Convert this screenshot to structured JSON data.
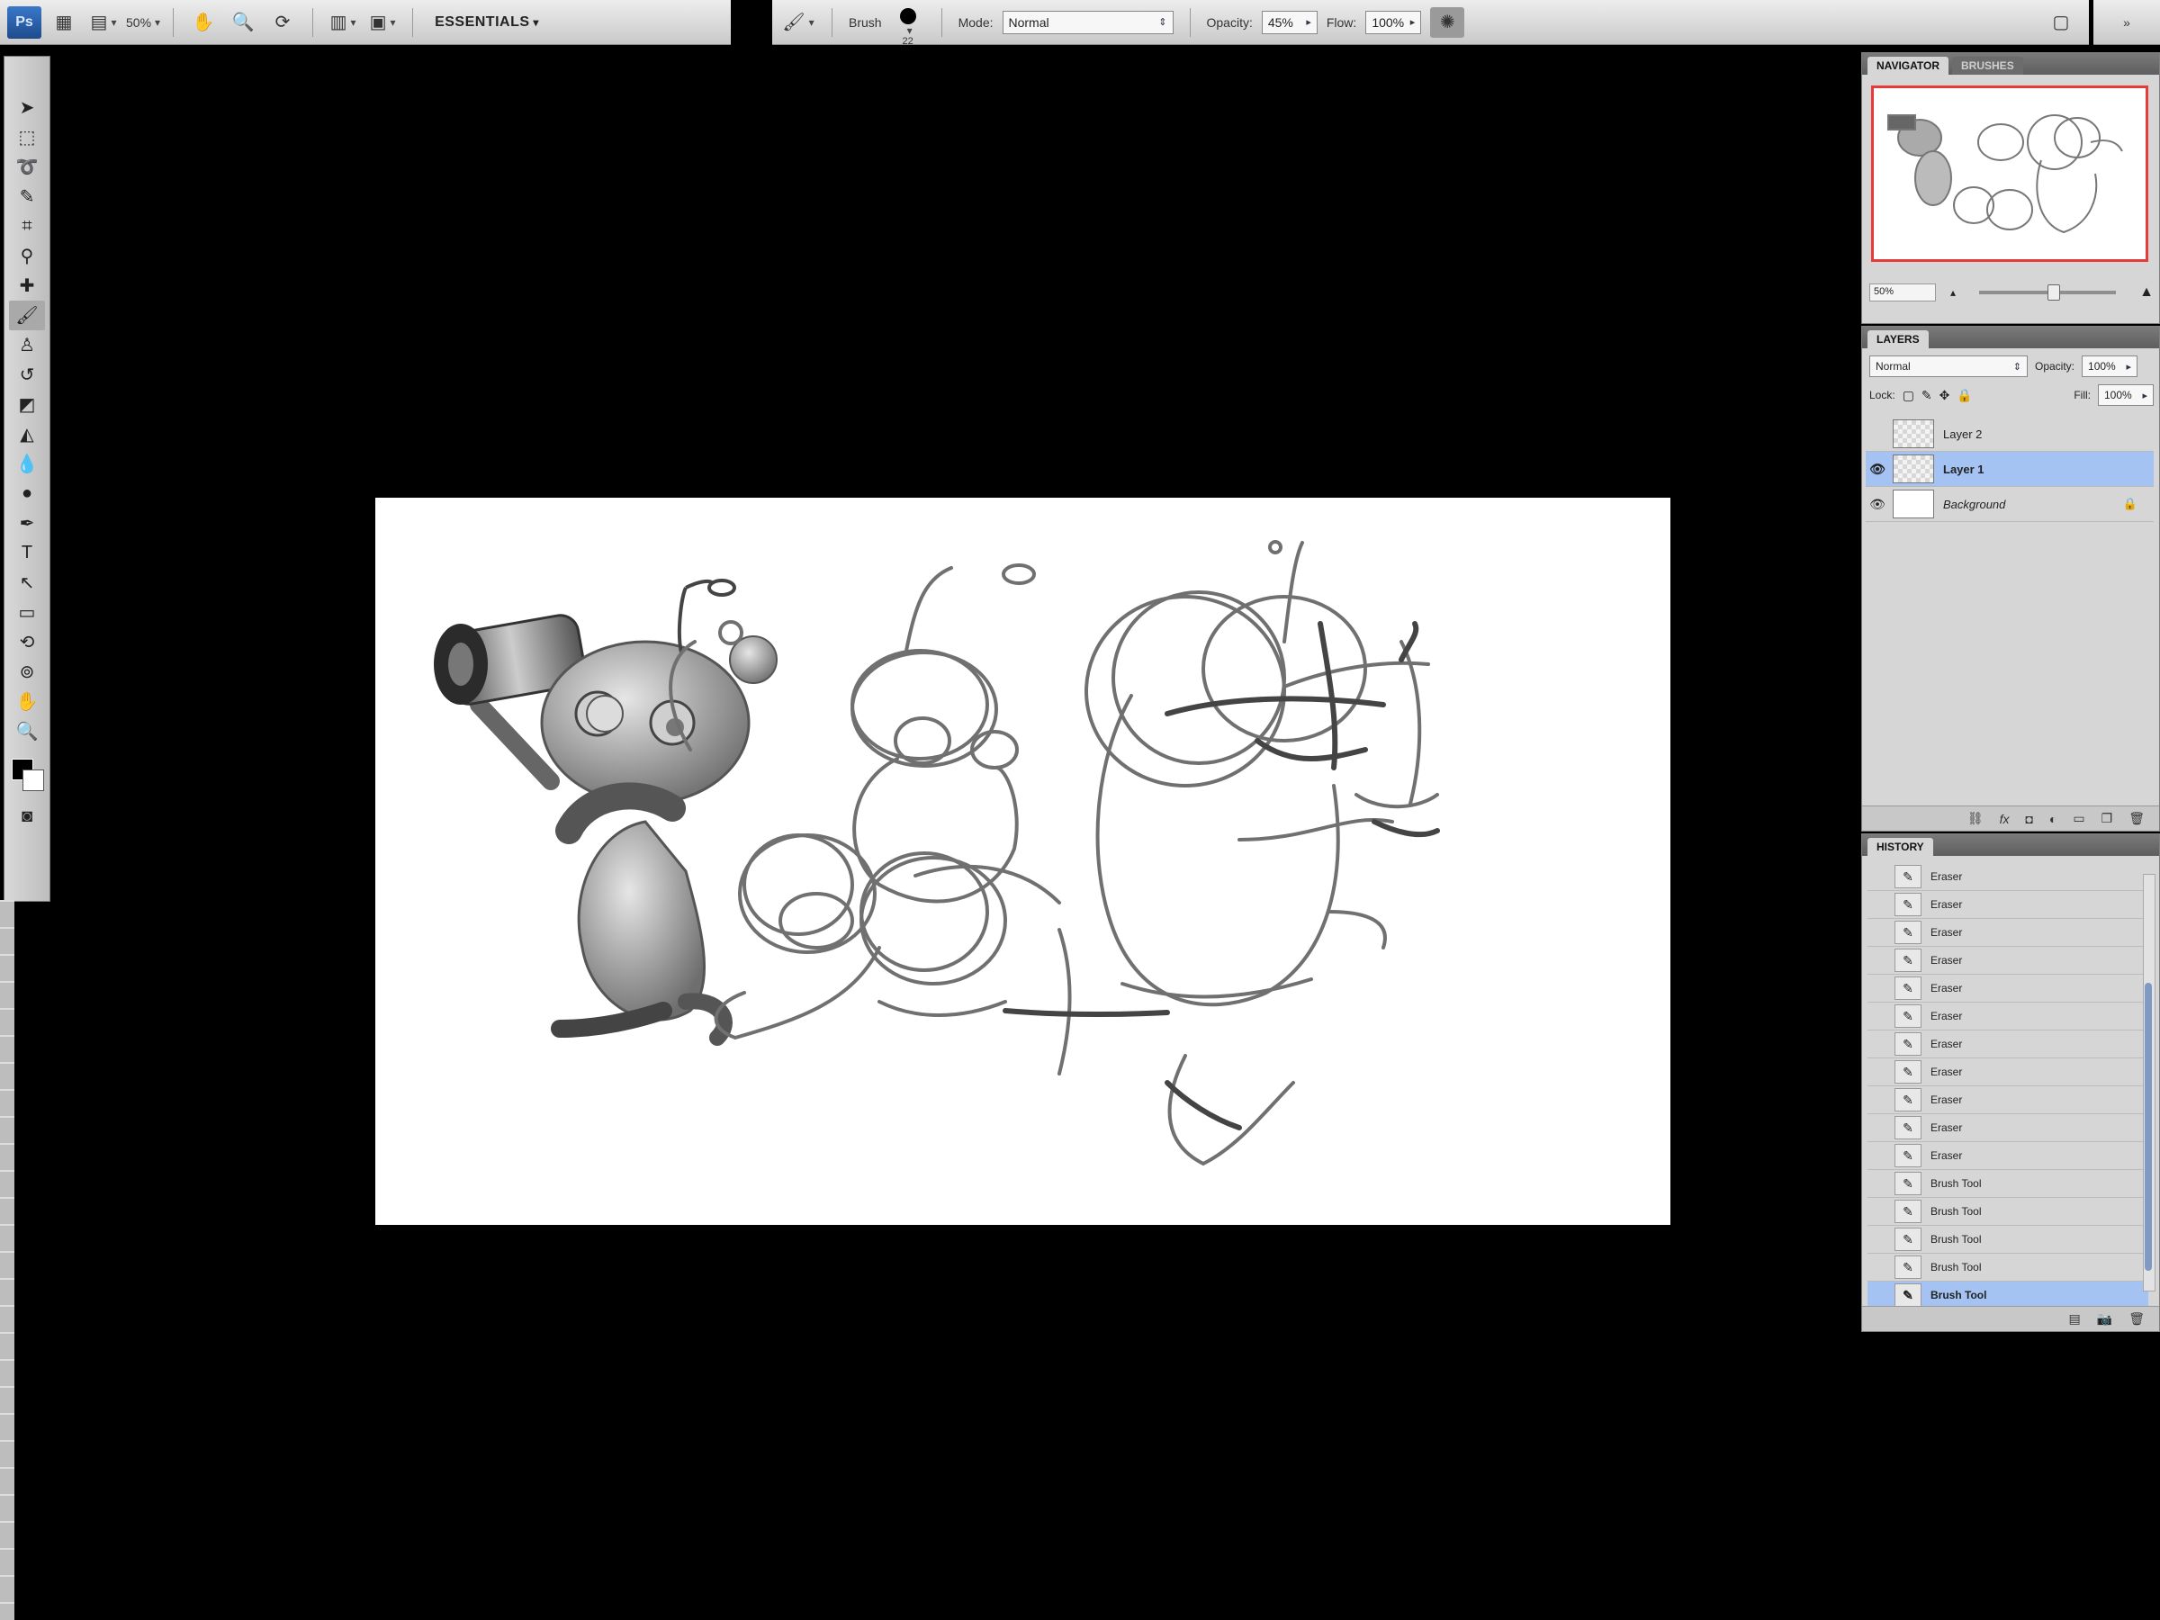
{
  "app": {
    "logo": "Ps",
    "zoom": "50%",
    "workspace": "ESSENTIALS"
  },
  "options": {
    "brush_label": "Brush",
    "brush_size": "22",
    "mode_label": "Mode:",
    "mode_value": "Normal",
    "opacity_label": "Opacity:",
    "opacity_value": "45%",
    "flow_label": "Flow:",
    "flow_value": "100%"
  },
  "navigator": {
    "tabs": [
      "NAVIGATOR",
      "BRUSHES"
    ],
    "zoom": "50%"
  },
  "layers": {
    "tab": "LAYERS",
    "blend_mode": "Normal",
    "opacity_label": "Opacity:",
    "opacity_value": "100%",
    "lock_label": "Lock:",
    "fill_label": "Fill:",
    "fill_value": "100%",
    "items": [
      {
        "name": "Layer 2",
        "visible": false,
        "selected": false
      },
      {
        "name": "Layer 1",
        "visible": true,
        "selected": true
      },
      {
        "name": "Background",
        "visible": true,
        "selected": false,
        "locked": true
      }
    ]
  },
  "history": {
    "tab": "HISTORY",
    "items": [
      "Eraser",
      "Eraser",
      "Eraser",
      "Eraser",
      "Eraser",
      "Eraser",
      "Eraser",
      "Eraser",
      "Eraser",
      "Eraser",
      "Eraser",
      "Brush Tool",
      "Brush Tool",
      "Brush Tool",
      "Brush Tool",
      "Brush Tool"
    ],
    "selected_index": 15
  },
  "colors": {
    "selection": "#a4c3f2",
    "nav_frame": "#e53b3b"
  }
}
